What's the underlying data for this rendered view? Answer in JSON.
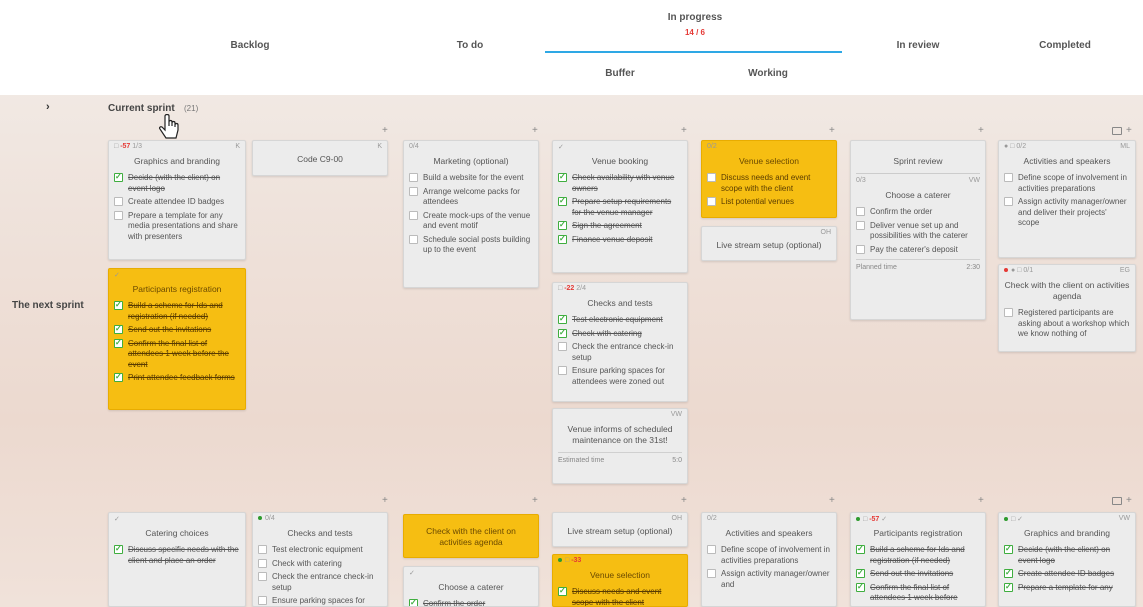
{
  "columns": {
    "backlog": "Backlog",
    "todo": "To do",
    "in_progress": "In progress",
    "in_progress_count": "14 / 6",
    "buffer": "Buffer",
    "working": "Working",
    "in_review": "In review",
    "completed": "Completed"
  },
  "lanes": {
    "current_sprint": "Current sprint",
    "current_sprint_count": "(21)",
    "next_sprint": "The next sprint",
    "toggle_icon": "chevron-right-icon"
  },
  "cards": {
    "graphics": {
      "overdue": "-57",
      "progress": "1/3",
      "owner": "K",
      "title": "Graphics and branding",
      "tasks": [
        "Decide (with the client) on event logo",
        "Create attendee ID badges",
        "Prepare a template for any media presentations and share with presenters"
      ]
    },
    "code": {
      "owner": "K",
      "title": "Code C9-00"
    },
    "marketing": {
      "progress": "0/4",
      "title": "Marketing (optional)",
      "tasks": [
        "Build a website for the event",
        "Arrange welcome packs for attendees",
        "Create mock-ups of the venue and event motif",
        "Schedule social posts building up to the event"
      ]
    },
    "venue_booking": {
      "title": "Venue booking",
      "tasks": [
        "Check availability with venue owners",
        "Prepare setup requirements for the venue manager",
        "Sign the agreement",
        "Finance venue deposit"
      ]
    },
    "venue_selection": {
      "progress": "0/2",
      "title": "Venue selection",
      "tasks": [
        "Discuss needs and event scope with the client",
        "List potential venues"
      ]
    },
    "livestream": {
      "owner": "OH",
      "title": "Live stream setup (optional)"
    },
    "sprint_review": {
      "title": "Sprint review",
      "sub_progress": "0/3",
      "sub_owner": "VW",
      "sub_title": "Choose a caterer",
      "tasks": [
        "Confirm the order",
        "Deliver venue set up and possibilities with the caterer",
        "Pay the caterer's deposit"
      ],
      "footer_label": "Planned time",
      "footer_value": "2:30"
    },
    "activities": {
      "progress": "0/2",
      "owner": "ML",
      "title": "Activities and speakers",
      "tasks": [
        "Define scope of involvement in activities preparations",
        "Assign activity manager/owner and deliver their projects' scope"
      ]
    },
    "check_client": {
      "progress": "0/1",
      "owner": "EG",
      "title": "Check with the client on activities agenda",
      "tasks": [
        "Registered participants are asking about a workshop which we know nothing of"
      ]
    },
    "participants": {
      "title": "Participants registration",
      "tasks": [
        "Build a scheme for Ids and registration (if needed)",
        "Send out the invitations",
        "Confirm the final list of attendees 1 week before the event",
        "Print attendee feedback forms"
      ]
    },
    "checks_tests": {
      "overdue": "-22",
      "progress": "2/4",
      "title": "Checks and tests",
      "tasks": [
        "Test electronic equipment",
        "Check with catering",
        "Check the entrance check-in setup",
        "Ensure parking spaces for attendees were zoned out"
      ]
    },
    "maintenance": {
      "owner": "VW",
      "title": "Venue informs of scheduled maintenance on the 31st!",
      "footer_label": "Estimated time",
      "footer_value": "5:0"
    },
    "next_catering": {
      "title": "Catering choices",
      "tasks": [
        "Discuss specific needs with the client and place an order"
      ]
    },
    "next_checks": {
      "progress": "0/4",
      "title": "Checks and tests",
      "tasks": [
        "Test electronic equipment",
        "Check with catering",
        "Check the entrance check-in setup",
        "Ensure parking spaces for"
      ]
    },
    "next_check_client": {
      "title": "Check with the client on activities agenda"
    },
    "next_caterer": {
      "title": "Choose a caterer",
      "tasks": [
        "Confirm the order"
      ]
    },
    "next_livestream": {
      "owner": "OH",
      "title": "Live stream setup (optional)"
    },
    "next_venue_sel": {
      "overdue": "-33",
      "title": "Venue selection",
      "tasks": [
        "Discuss needs and event scope with the client"
      ]
    },
    "next_activities": {
      "progress": "0/2",
      "title": "Activities and speakers",
      "tasks": [
        "Define scope of involvement in activities preparations",
        "Assign activity manager/owner and"
      ]
    },
    "next_participants": {
      "overdue": "-57",
      "title": "Participants registration",
      "tasks": [
        "Build a scheme for Ids and registration (if needed)",
        "Send out the invitations",
        "Confirm the final list of attendees 1 week before"
      ]
    },
    "next_graphics": {
      "owner": "VW",
      "title": "Graphics and branding",
      "tasks": [
        "Decide (with the client) on event logo",
        "Create attendee ID badges",
        "Prepare a template for any"
      ]
    }
  },
  "colors": {
    "accent": "#2ea8e5",
    "card_yellow": "#f6be12",
    "overdue": "#e53935",
    "check": "#3fae3f"
  }
}
